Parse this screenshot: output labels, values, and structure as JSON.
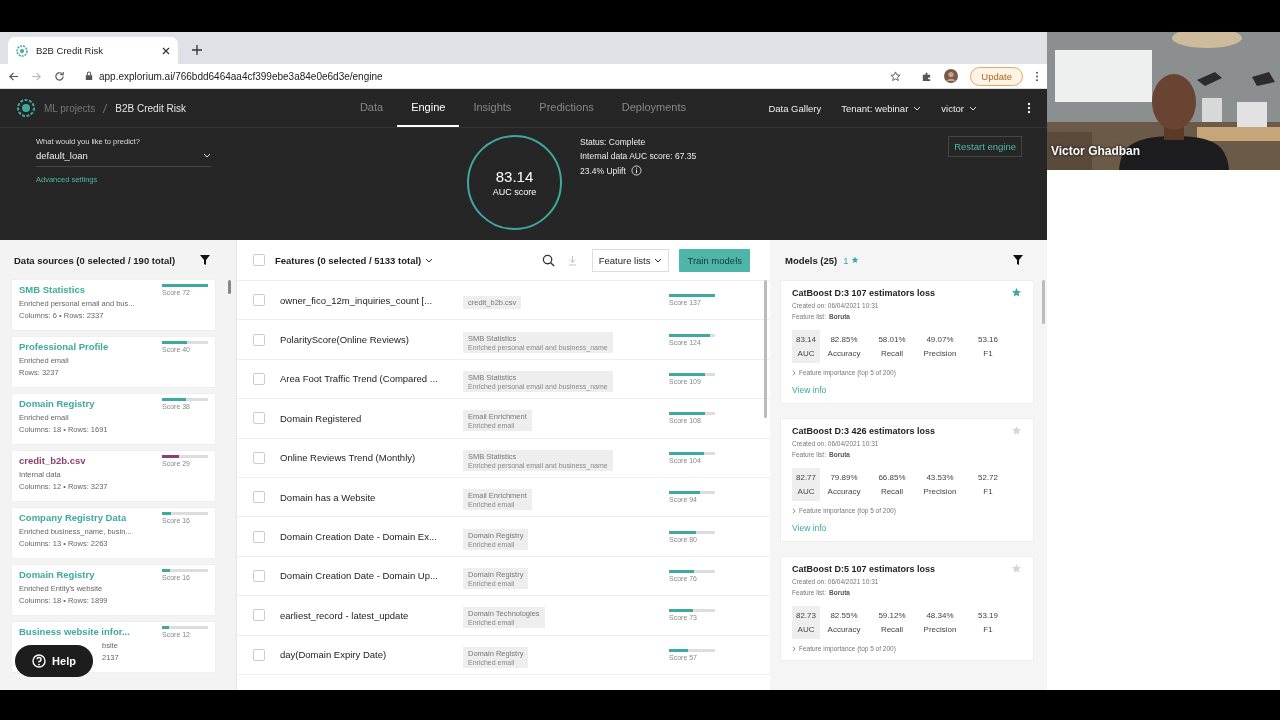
{
  "browser": {
    "tab_title": "B2B Credit Risk",
    "url": "app.explorium.ai/766bdd6464aa4cf399ebe3a84e0e6d3e/engine",
    "update_label": "Update"
  },
  "app_nav": {
    "breadcrumb": [
      "ML projects",
      "B2B Credit Risk"
    ],
    "tabs": [
      {
        "label": "Data",
        "selected": false
      },
      {
        "label": "Engine",
        "selected": true
      },
      {
        "label": "Insights",
        "selected": false
      },
      {
        "label": "Predictions",
        "selected": false
      },
      {
        "label": "Deployments",
        "selected": false
      }
    ],
    "right": {
      "gallery": "Data Gallery",
      "tenant": "Tenant: webinar",
      "user": "victor"
    }
  },
  "engine": {
    "predict_label": "What would you like to predict?",
    "predict_value": "default_loan",
    "advanced": "Advanced settings",
    "auc": "83.14",
    "auc_label": "AUC score",
    "status": "Status: Complete",
    "internal_auc": "Internal data AUC score: 67.35",
    "uplift": "23.4% Uplift",
    "restart": "Restart engine"
  },
  "data_sources": {
    "title": "Data sources (0 selected / 190 total)",
    "items": [
      {
        "name": "SMB Statistics",
        "desc": "Enriched personal email and bus...",
        "meta": "Columns: 6 • Rows: 2337",
        "score": "Score 72",
        "level": 1.0,
        "color": "#3fa9a0",
        "covered": false
      },
      {
        "name": "Professional Profile",
        "desc": "Enriched email",
        "meta": "Rows: 3237",
        "score": "Score 40",
        "level": 0.55,
        "color": "#3fa9a0",
        "covered": false
      },
      {
        "name": "Domain Registry",
        "desc": "Enriched email",
        "meta": "Columns: 18 • Rows: 1691",
        "score": "Score 38",
        "level": 0.53,
        "color": "#3fa9a0",
        "covered": false
      },
      {
        "name": "credit_b2b.csv",
        "desc": "Internal data",
        "meta": "Columns: 12 • Rows: 3237",
        "score": "Score 29",
        "level": 0.38,
        "color": "#8c3f74",
        "covered": false
      },
      {
        "name": "Company Registry Data",
        "desc": "Enriched business_name, busin...",
        "meta": "Columns: 13 • Rows: 2263",
        "score": "Score 16",
        "level": 0.2,
        "color": "#3fa9a0",
        "covered": false
      },
      {
        "name": "Domain Registry",
        "desc": "Enriched Entity's website",
        "meta": "Columns: 18 • Rows: 1899",
        "score": "Score 16",
        "level": 0.18,
        "color": "#3fa9a0",
        "covered": false
      },
      {
        "name": "Business website infor...",
        "desc": "bsite",
        "meta": "2137",
        "score": "Score 12",
        "level": 0.15,
        "color": "#3fa9a0",
        "covered": true
      }
    ]
  },
  "help": "Help",
  "features": {
    "title": "Features (0 selected / 5133 total)",
    "all_checked": false,
    "lists_button": "Feature lists",
    "train_button": "Train models",
    "rows": [
      {
        "name": "owner_fico_12m_inquiries_count [...",
        "source": "credit_b2b.csv",
        "score": "Score 137",
        "level": 1.0,
        "checked": false
      },
      {
        "name": "PolarityScore(Online Reviews)",
        "source": "SMB Statistics",
        "source_desc": "Enriched personal email and business_name",
        "score": "Score 124",
        "level": 0.9,
        "checked": false
      },
      {
        "name": "Area Foot Traffic Trend (Compared ...",
        "source": "SMB Statistics",
        "source_desc": "Enriched personal email and business_name",
        "score": "Score 109",
        "level": 0.78,
        "checked": false
      },
      {
        "name": "Domain Registered",
        "source": "Email Enrichment",
        "source_desc": "Enriched email",
        "score": "Score 108",
        "level": 0.78,
        "checked": false
      },
      {
        "name": "Online Reviews Trend (Monthly)",
        "source": "SMB Statistics",
        "source_desc": "Enriched personal email and business_name",
        "score": "Score 104",
        "level": 0.76,
        "checked": false
      },
      {
        "name": "Domain has a Website",
        "source": "Email Enrichment",
        "source_desc": "Enriched email",
        "score": "Score 94",
        "level": 0.68,
        "checked": false
      },
      {
        "name": "Domain Creation Date - Domain Ex...",
        "source": "Domain Registry",
        "source_desc": "Enriched email",
        "score": "Score 80",
        "level": 0.58,
        "checked": false
      },
      {
        "name": "Domain Creation Date - Domain Up...",
        "source": "Domain Registry",
        "source_desc": "Enriched email",
        "score": "Score 76",
        "level": 0.55,
        "checked": false
      },
      {
        "name": "earliest_record - latest_update",
        "source": "Domain Technologies",
        "source_desc": "Enriched email",
        "score": "Score 73",
        "level": 0.53,
        "checked": false
      },
      {
        "name": "day(Domain Expiry Date)",
        "source": "Domain Registry",
        "source_desc": "Enriched email",
        "score": "Score 57",
        "level": 0.41,
        "checked": false
      }
    ]
  },
  "models": {
    "title": "Models (25)",
    "starred_count": "1",
    "cards": [
      {
        "name": "CatBoost D:3 107 estimators loss",
        "created": "Created on: 06/04/2021 10:31",
        "feature_list_label": "Feature list:",
        "feature_list": "Boruta",
        "starred": true,
        "metrics": [
          {
            "value": "83.14",
            "label": "AUC"
          },
          {
            "value": "82.85%",
            "label": "Accuracy"
          },
          {
            "value": "58.01%",
            "label": "Recall"
          },
          {
            "value": "49.07%",
            "label": "Precision"
          },
          {
            "value": "53.16",
            "label": "F1"
          }
        ],
        "importance": "Feature importance (top 5 of 200)",
        "view_info": "View info"
      },
      {
        "name": "CatBoost D:3 426 estimators loss",
        "created": "Created on: 06/04/2021 10:31",
        "feature_list_label": "Feature list:",
        "feature_list": "Boruta",
        "starred": false,
        "metrics": [
          {
            "value": "82.77",
            "label": "AUC"
          },
          {
            "value": "79.89%",
            "label": "Accuracy"
          },
          {
            "value": "66.85%",
            "label": "Recall"
          },
          {
            "value": "43.53%",
            "label": "Precision"
          },
          {
            "value": "52.72",
            "label": "F1"
          }
        ],
        "importance": "Feature importance (top 5 of 200)",
        "view_info": "View info"
      },
      {
        "name": "CatBoost D:5 107 estimators loss",
        "created": "Created on: 06/04/2021 10:31",
        "feature_list_label": "Feature list:",
        "feature_list": "Boruta",
        "starred": false,
        "metrics": [
          {
            "value": "82.73",
            "label": "AUC"
          },
          {
            "value": "82.55%",
            "label": "Accuracy"
          },
          {
            "value": "59.12%",
            "label": "Recall"
          },
          {
            "value": "48.34%",
            "label": "Precision"
          },
          {
            "value": "53.19",
            "label": "F1"
          }
        ],
        "importance": "Feature importance (top 5 of 200)"
      }
    ]
  },
  "video": {
    "kind": "picture",
    "name": "Victor Ghadban"
  }
}
